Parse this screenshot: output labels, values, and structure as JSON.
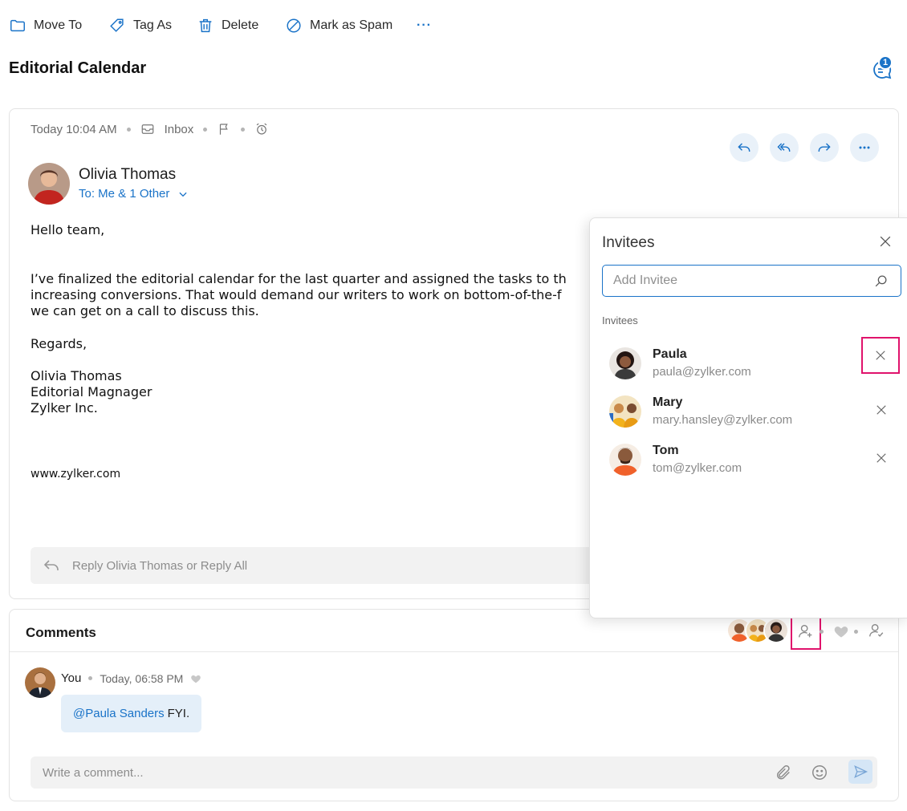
{
  "toolbar": {
    "move_to": "Move To",
    "tag_as": "Tag As",
    "delete": "Delete",
    "mark_spam": "Mark as Spam",
    "more": "···"
  },
  "subject": "Editorial Calendar",
  "chat_badge_count": "1",
  "mail": {
    "time": "Today 10:04 AM",
    "folder": "Inbox",
    "sender_name": "Olivia Thomas",
    "recipients": "To: Me & 1 Other",
    "body": {
      "greeting": "Hello team,",
      "line1": "I’ve finalized the editorial calendar for the last quarter and assigned the tasks to th",
      "line2": "increasing conversions. That would demand our writers to work on bottom-of-the-f",
      "line3": "we can get on a call to discuss this.",
      "regards": "Regards,",
      "sig_name": "Olivia Thomas",
      "sig_title": "Editorial Magnager",
      "sig_company": "Zylker Inc.",
      "website": "www.zylker.com"
    },
    "reply_prompt": "Reply Olivia Thomas or Reply All"
  },
  "comments": {
    "title": "Comments",
    "author": "You",
    "timestamp": "Today, 06:58 PM",
    "mention": "@Paula Sanders",
    "text": "FYI.",
    "input_placeholder": "Write a comment..."
  },
  "invitees_panel": {
    "title": "Invitees",
    "search_placeholder": "Add Invitee",
    "section_label": "Invitees",
    "people": [
      {
        "name": "Paula",
        "email": "paula@zylker.com"
      },
      {
        "name": "Mary",
        "email": "mary.hansley@zylker.com"
      },
      {
        "name": "Tom",
        "email": "tom@zylker.com"
      }
    ]
  },
  "colors": {
    "accent": "#1a73c8",
    "highlight": "#e0136c",
    "bubble": "#e4eff9"
  }
}
